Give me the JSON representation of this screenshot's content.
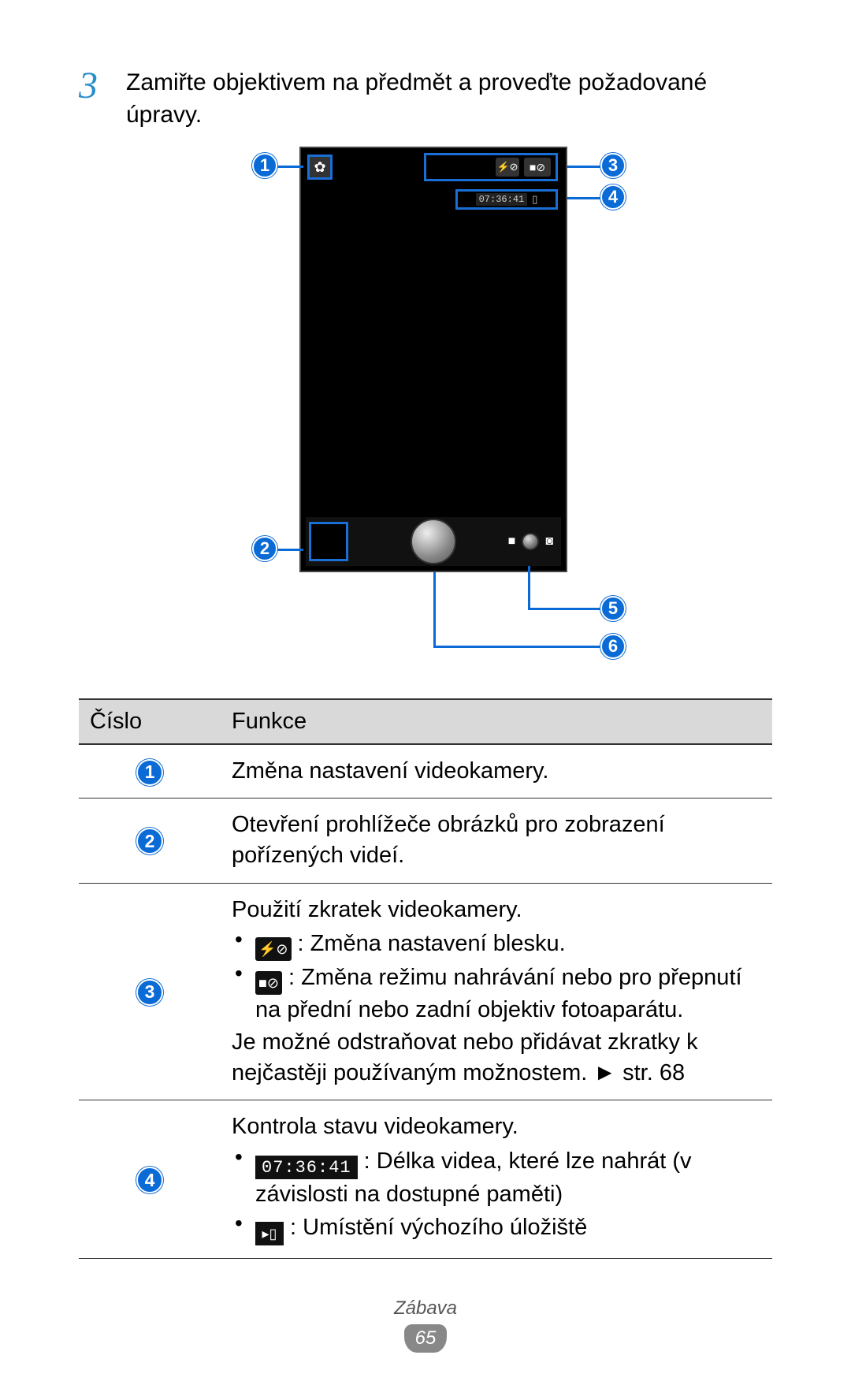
{
  "step": {
    "number": "3",
    "text": "Zamiřte objektivem na předmět a proveďte požadované úpravy."
  },
  "diagram": {
    "time_label": "07:36:41",
    "callouts": [
      "1",
      "2",
      "3",
      "4",
      "5",
      "6"
    ]
  },
  "table": {
    "headers": {
      "num": "Číslo",
      "func": "Funkce"
    },
    "rows": {
      "r1": {
        "num": "1",
        "text": "Změna nastavení videokamery."
      },
      "r2": {
        "num": "2",
        "text": "Otevření prohlížeče obrázků pro zobrazení pořízených videí."
      },
      "r3": {
        "num": "3",
        "intro": "Použití zkratek videokamery.",
        "b1_after": " : Změna nastavení blesku.",
        "b2_after": " : Změna režimu nahrávání nebo pro přepnutí na přední nebo zadní objektiv fotoaparátu.",
        "outro": "Je možné odstraňovat nebo přidávat zkratky k nejčastěji používaným možnostem. ► str. 68"
      },
      "r4": {
        "num": "4",
        "intro": "Kontrola stavu videokamery.",
        "time_value": "07:36:41",
        "b1_after": " : Délka videa, které lze nahrát (v závislosti na dostupné paměti)",
        "b2_after": " : Umístění výchozího úložiště"
      }
    }
  },
  "footer": {
    "section": "Zábava",
    "page": "65"
  }
}
